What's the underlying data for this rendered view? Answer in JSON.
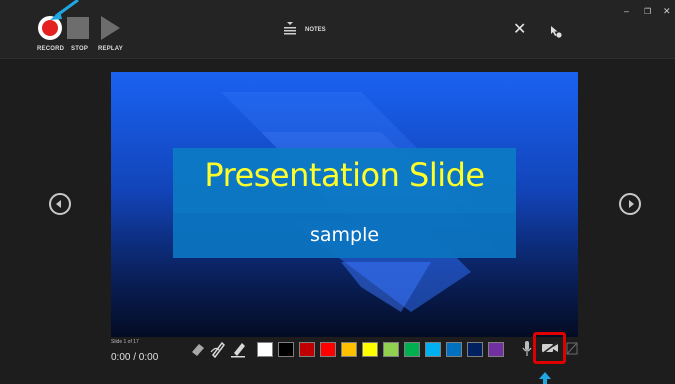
{
  "toolbar": {
    "record_label": "RECORD",
    "stop_label": "STOP",
    "replay_label": "REPLAY",
    "notes_label": "NOTES"
  },
  "slide": {
    "title": "Presentation Slide",
    "subtitle": "sample"
  },
  "status": {
    "slide_counter": "Slide 1 of 17",
    "timer": "0:00 / 0:00"
  },
  "colors": {
    "record": "#e52021",
    "highlight_box": "#e10000",
    "callout_arrow": "#1fa7e3",
    "title_text": "#ffff2a"
  },
  "icons": [
    "record-icon",
    "stop-icon",
    "replay-icon",
    "notes-icon",
    "close-icon",
    "pointer-icon",
    "minimize-icon",
    "maximize-icon",
    "window-close-icon",
    "previous-slide-icon",
    "next-slide-icon",
    "eraser-icon",
    "pen-icon",
    "highlighter-icon",
    "microphone-icon",
    "camera-icon",
    "camera-preview-icon"
  ],
  "ink_colors": [
    "#ffffff",
    "#000000",
    "#c00000",
    "#ff0000",
    "#ffc000",
    "#ffff00",
    "#92d050",
    "#00b050",
    "#00b0f0",
    "#0070c0",
    "#002060",
    "#7030a0"
  ]
}
